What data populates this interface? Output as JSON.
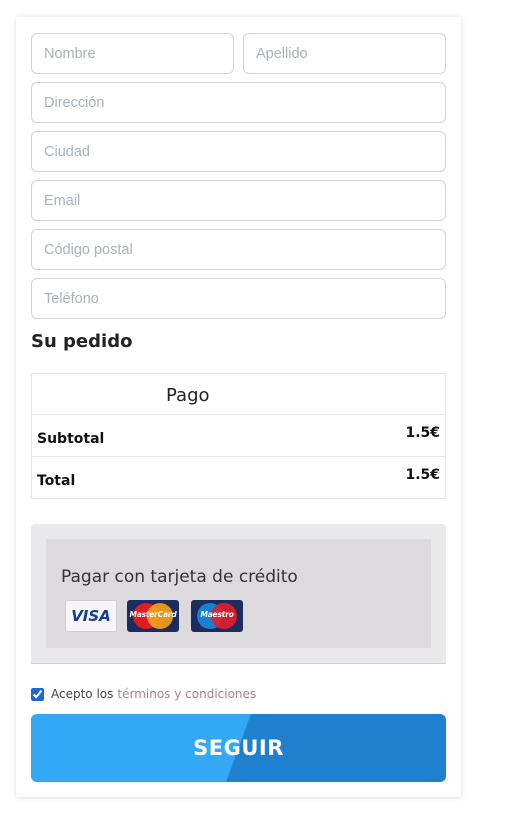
{
  "form": {
    "first_name": {
      "placeholder": "Nombre",
      "value": ""
    },
    "last_name": {
      "placeholder": "Apellido",
      "value": ""
    },
    "address": {
      "placeholder": "Dirección",
      "value": ""
    },
    "city": {
      "placeholder": "Ciudad",
      "value": ""
    },
    "email": {
      "placeholder": "Email",
      "value": ""
    },
    "postal_code": {
      "placeholder": "Código postal",
      "value": ""
    },
    "phone": {
      "placeholder": "Teléfono",
      "value": ""
    }
  },
  "order": {
    "title": "Su pedido",
    "header": "Pago",
    "rows": [
      {
        "label": "Subtotal",
        "amount": "1.5€"
      },
      {
        "label": "Total",
        "amount": "1.5€"
      }
    ]
  },
  "payment": {
    "label": "Pagar con tarjeta de crédito",
    "cards": [
      {
        "name": "VISA",
        "icon": "visa-logo"
      },
      {
        "name": "MasterCard",
        "icon": "mastercard-logo"
      },
      {
        "name": "Maestro",
        "icon": "maestro-logo"
      }
    ]
  },
  "terms": {
    "checked": true,
    "prefix": "Acepto los",
    "link": "términos y condiciones"
  },
  "submit": {
    "label": "SEGUIR"
  },
  "colors": {
    "button_light": "#33a8f6",
    "button_dark": "#2080d0",
    "link": "#b07d8b",
    "payment_bg": "#e9e8ea"
  }
}
